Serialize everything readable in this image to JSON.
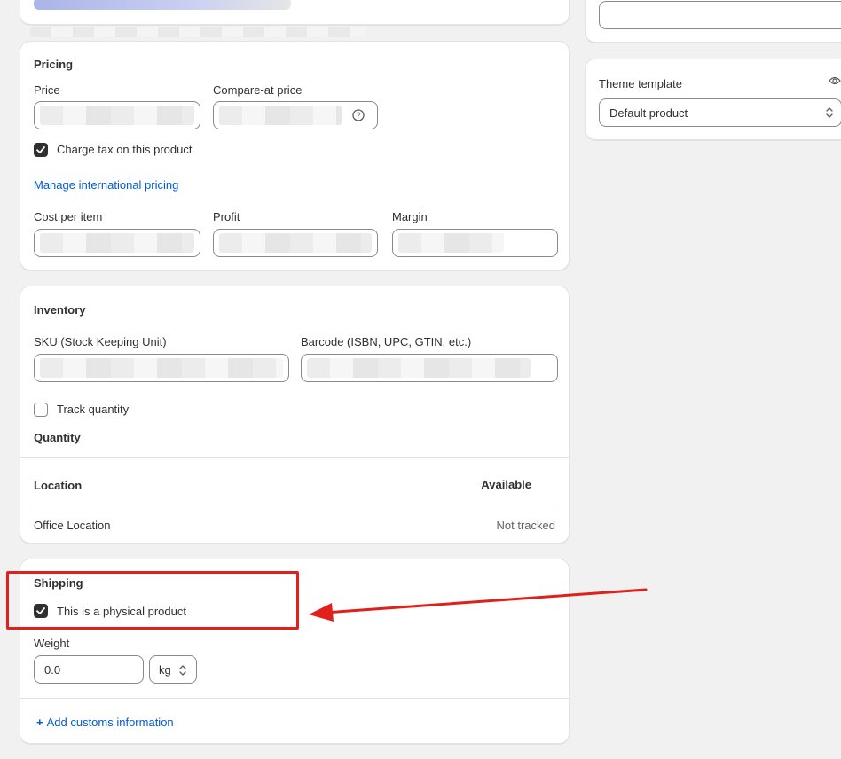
{
  "pricing": {
    "title": "Pricing",
    "price_label": "Price",
    "compare_label": "Compare-at price",
    "charge_tax_label": "Charge tax on this product",
    "charge_tax_checked": true,
    "manage_intl_link": "Manage international pricing",
    "cost_label": "Cost per item",
    "profit_label": "Profit",
    "margin_label": "Margin"
  },
  "inventory": {
    "title": "Inventory",
    "sku_label": "SKU (Stock Keeping Unit)",
    "barcode_label": "Barcode (ISBN, UPC, GTIN, etc.)",
    "track_quantity_label": "Track quantity",
    "track_quantity_checked": false,
    "quantity_title": "Quantity",
    "col_location": "Location",
    "col_available": "Available",
    "rows": [
      {
        "location": "Office Location",
        "available": "Not tracked"
      }
    ]
  },
  "shipping": {
    "title": "Shipping",
    "physical_label": "This is a physical product",
    "physical_checked": true,
    "weight_label": "Weight",
    "weight_value": "0.0",
    "unit_value": "kg",
    "customs_link": "Add customs information"
  },
  "sidebar": {
    "theme_template_label": "Theme template",
    "theme_template_value": "Default product"
  },
  "annotation": {
    "highlight_color": "#e0201b"
  },
  "colors": {
    "link": "#005bd3",
    "checkbox_on": "#303030",
    "page_bg": "#f1f1f1"
  }
}
